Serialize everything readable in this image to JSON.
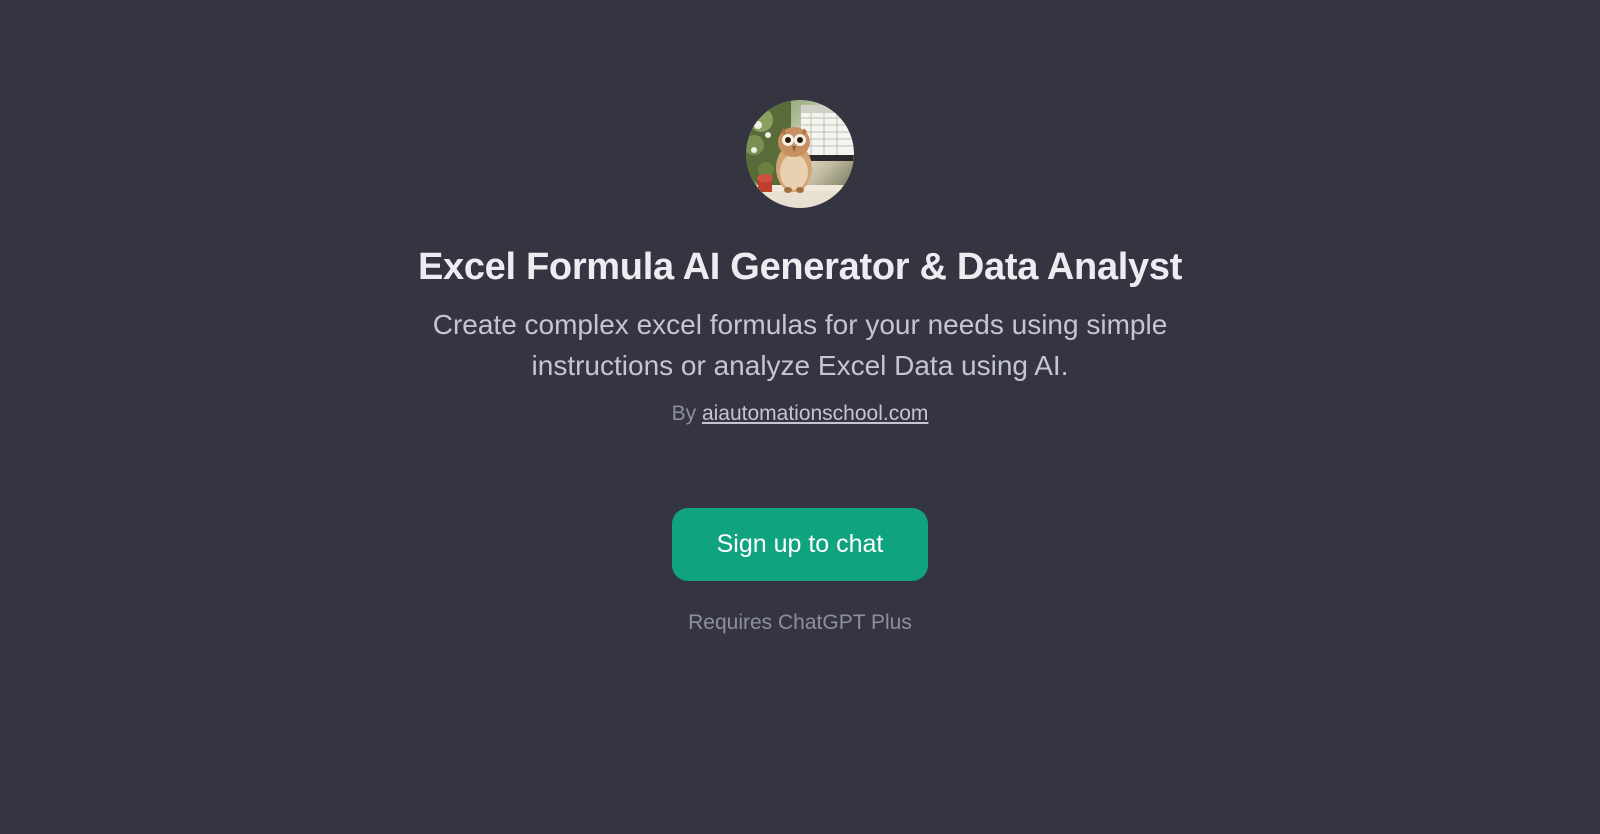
{
  "avatar": {
    "alt": "owl-spreadsheet-icon"
  },
  "title": "Excel Formula AI Generator & Data Analyst",
  "description": "Create complex excel formulas for your needs using simple instructions or analyze Excel Data using AI.",
  "author": {
    "prefix": "By ",
    "link_text": "aiautomationschool.com"
  },
  "cta": {
    "label": "Sign up to chat"
  },
  "requirement": "Requires ChatGPT Plus"
}
